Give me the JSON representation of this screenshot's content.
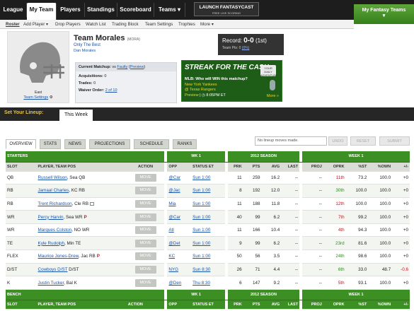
{
  "nav": {
    "tabs": [
      "League",
      "My Team",
      "Players",
      "Standings",
      "Scoreboard",
      "Teams"
    ],
    "teams_arrow": "▾",
    "launch_title": "LAUNCH FANTASYCAST",
    "launch_sub": "FREE LIVE SCORING",
    "my_fantasy_teams": "My Fantasy Teams",
    "my_fantasy_arrow": "▾"
  },
  "subnav": [
    "Roster",
    "Add Player ▾",
    "Drop Players",
    "Watch List",
    "Trading Block",
    "Team Settings",
    "Trophies",
    "More ▾"
  ],
  "team": {
    "name": "Team Morales",
    "abbr": "(MORA)",
    "motto": "Only The Best",
    "owner": "Dan Morales",
    "division": "East",
    "settings_link": "Team Settings",
    "record_label": "Record:",
    "record_value": "0-0",
    "record_rank": "(1st)",
    "team_pts": "Team Pts: 0",
    "team_pts_rank": "(0%)"
  },
  "matchup": {
    "label": "Current Matchup:",
    "vs": "vs",
    "opponent": "Faulty",
    "preview": "Preview",
    "acq_label": "Acquisitions:",
    "acq_value": "0",
    "trades_label": "Trades:",
    "trades_value": "0",
    "waiver_label": "Waiver Order:",
    "waiver_value": "2 of 10"
  },
  "streak": {
    "logo": "STREAK FOR THE CASH",
    "badge": "YOUR DAILY ADVENTURE ⓘ",
    "question": "MLB: Who will WIN this matchup?",
    "answer1": "New York Yankees",
    "answer2": "@ Texas Rangers",
    "preview": "Preview",
    "time": "8:05PM ET",
    "more": "More »"
  },
  "lineup": {
    "label": "Set Your Lineup:",
    "this_week": "This Week",
    "tabs": [
      "OVERVIEW",
      "STATS",
      "NEWS",
      "PROJECTIONS",
      "SCHEDULE",
      "RANKS"
    ],
    "no_moves": "No lineup moves made.",
    "undo": "UNDO",
    "reset": "RESET",
    "submit": "SUBMIT"
  },
  "table": {
    "sections": {
      "starters": "STARTERS",
      "bench": "BENCH",
      "wk": "WK 1",
      "season": "2012 SEASON",
      "week": "WEEK 1"
    },
    "cols": [
      "SLOT",
      "PLAYER, TEAM POS",
      "ACTION",
      "OPP",
      "STATUS ET",
      "PRK",
      "PTS",
      "AVG",
      "LAST",
      "PROJ",
      "OPRK",
      "%ST",
      "%OWN",
      "+/-"
    ],
    "move_label": "MOVE",
    "rows": [
      {
        "slot": "QB",
        "player": "Russell Wilson",
        "team": ", Sea QB",
        "flag": "",
        "opp": "@Car",
        "status": "Sun 1:00",
        "prk": "11",
        "pts": "259",
        "avg": "16.2",
        "last": "--",
        "proj": "--",
        "oprk": "11th",
        "oprk_color": "red",
        "st": "73.2",
        "own": "100.0",
        "pm": "+0"
      },
      {
        "slot": "RB",
        "player": "Jamaal Charles",
        "team": ", KC RB",
        "flag": "",
        "opp": "@Jac",
        "status": "Sun 1:00",
        "prk": "8",
        "pts": "192",
        "avg": "12.0",
        "last": "--",
        "proj": "--",
        "oprk": "30th",
        "oprk_color": "green",
        "st": "100.0",
        "own": "100.0",
        "pm": "+0"
      },
      {
        "slot": "RB",
        "player": "Trent Richardson",
        "team": ", Cle RB",
        "flag": "note",
        "opp": "Mia",
        "status": "Sun 1:00",
        "prk": "11",
        "pts": "188",
        "avg": "11.8",
        "last": "--",
        "proj": "--",
        "oprk": "12th",
        "oprk_color": "red",
        "st": "100.0",
        "own": "100.0",
        "pm": "+0"
      },
      {
        "slot": "WR",
        "player": "Percy Harvin",
        "team": ", Sea WR",
        "flag": "P",
        "opp": "@Car",
        "status": "Sun 1:00",
        "prk": "40",
        "pts": "99",
        "avg": "6.2",
        "last": "--",
        "proj": "--",
        "oprk": "7th",
        "oprk_color": "red",
        "st": "99.2",
        "own": "100.0",
        "pm": "+0"
      },
      {
        "slot": "WR",
        "player": "Marques Colston",
        "team": ", NO WR",
        "flag": "",
        "opp": "Atl",
        "status": "Sun 1:00",
        "prk": "11",
        "pts": "166",
        "avg": "10.4",
        "last": "--",
        "proj": "--",
        "oprk": "4th",
        "oprk_color": "red",
        "st": "94.3",
        "own": "100.0",
        "pm": "+0"
      },
      {
        "slot": "TE",
        "player": "Kyle Rudolph",
        "team": ", Min TE",
        "flag": "",
        "opp": "@Det",
        "status": "Sun 1:00",
        "prk": "9",
        "pts": "99",
        "avg": "6.2",
        "last": "--",
        "proj": "--",
        "oprk": "23rd",
        "oprk_color": "green",
        "st": "81.6",
        "own": "100.0",
        "pm": "+0"
      },
      {
        "slot": "FLEX",
        "player": "Maurice Jones-Drew",
        "team": ", Jac RB",
        "flag": "P",
        "opp": "KC",
        "status": "Sun 1:00",
        "prk": "50",
        "pts": "56",
        "avg": "3.5",
        "last": "--",
        "proj": "--",
        "oprk": "24th",
        "oprk_color": "green",
        "st": "98.6",
        "own": "100.0",
        "pm": "+0"
      },
      {
        "slot": "D/ST",
        "player": "Cowboys D/ST",
        "team": " D/ST",
        "flag": "",
        "opp": "NYG",
        "status": "Sun 8:30",
        "prk": "26",
        "pts": "71",
        "avg": "4.4",
        "last": "--",
        "proj": "--",
        "oprk": "6th",
        "oprk_color": "green",
        "st": "33.0",
        "own": "48.7",
        "pm": "-0.6"
      },
      {
        "slot": "K",
        "player": "Justin Tucker",
        "team": ", Bal K",
        "flag": "",
        "opp": "@Den",
        "status": "Thu 8:30",
        "prk": "6",
        "pts": "147",
        "avg": "9.2",
        "last": "--",
        "proj": "--",
        "oprk": "5th",
        "oprk_color": "red",
        "st": "93.1",
        "own": "100.0",
        "pm": "+0"
      }
    ]
  }
}
